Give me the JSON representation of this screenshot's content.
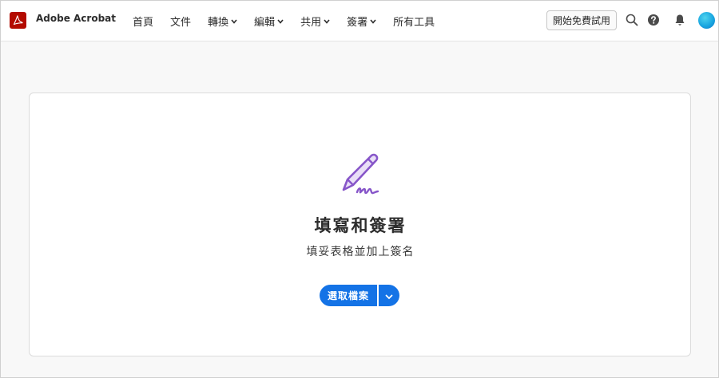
{
  "header": {
    "app_name": "Adobe Acrobat",
    "nav": [
      {
        "label": "首頁",
        "has_dropdown": false
      },
      {
        "label": "文件",
        "has_dropdown": false
      },
      {
        "label": "轉換",
        "has_dropdown": true
      },
      {
        "label": "編輯",
        "has_dropdown": true
      },
      {
        "label": "共用",
        "has_dropdown": true
      },
      {
        "label": "簽署",
        "has_dropdown": true
      },
      {
        "label": "所有工具",
        "has_dropdown": false
      }
    ],
    "trial_label": "開始免費試用",
    "icons": [
      "search-icon",
      "help-icon",
      "bell-icon"
    ]
  },
  "card": {
    "icon": "pen-signature-icon",
    "title": "填寫和簽署",
    "subtitle": "填妥表格並加上簽名",
    "primary_button": "選取檔案"
  },
  "colors": {
    "brand_red": "#b30b00",
    "accent_blue": "#1473e6",
    "icon_purple": "#8756c9"
  }
}
